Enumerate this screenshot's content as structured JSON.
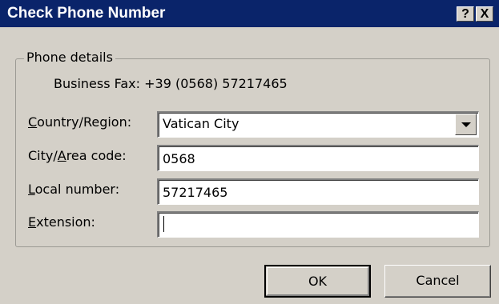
{
  "window": {
    "title": "Check Phone Number",
    "help_label": "?",
    "close_label": "X"
  },
  "phone_details": {
    "group_label": "Phone details",
    "business_fax": "Business Fax: +39 (0568) 57217465"
  },
  "fields": {
    "country": {
      "label_prefix": "",
      "label_mnemonic": "C",
      "label_rest": "ountry/Region:",
      "value": "Vatican City"
    },
    "city": {
      "label_prefix": "City/",
      "label_mnemonic": "A",
      "label_rest": "rea code:",
      "value": "0568"
    },
    "local": {
      "label_prefix": "",
      "label_mnemonic": "L",
      "label_rest": "ocal number:",
      "value": "57217465"
    },
    "extension": {
      "label_prefix": "",
      "label_mnemonic": "E",
      "label_rest": "xtension:",
      "value": ""
    }
  },
  "buttons": {
    "ok_label": "OK",
    "cancel_label": "Cancel"
  }
}
